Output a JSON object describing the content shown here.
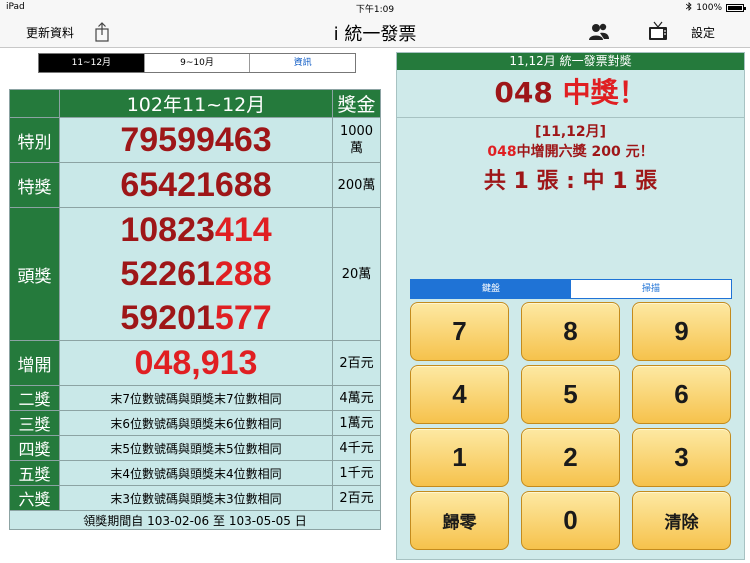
{
  "status": {
    "device": "iPad",
    "time": "下午1:09",
    "battery": "100%"
  },
  "nav": {
    "update_label": "更新資料",
    "title": "i 統一發票",
    "settings_label": "設定"
  },
  "left_tabs": [
    {
      "label": "11~12月",
      "active": true
    },
    {
      "label": "9~10月",
      "active": false
    },
    {
      "label": "資訊",
      "active": false
    }
  ],
  "table": {
    "header_title": "102年11~12月",
    "header_prize": "獎金",
    "special": {
      "label": "特別",
      "number": "79599463",
      "amount_line1": "1000",
      "amount_line2": "萬"
    },
    "grand": {
      "label": "特獎",
      "number": "65421688",
      "amount": "200萬"
    },
    "first": {
      "label": "頭獎",
      "amount": "20萬",
      "numbers": [
        {
          "head": "10823",
          "tail": "414"
        },
        {
          "head": "52261",
          "tail": "288"
        },
        {
          "head": "59201",
          "tail": "577"
        }
      ]
    },
    "extra": {
      "label": "增開",
      "number": "048,913",
      "amount": "2百元"
    },
    "rules": [
      {
        "label": "二獎",
        "desc": "末7位數號碼與頭獎末7位數相同",
        "amount": "4萬元"
      },
      {
        "label": "三獎",
        "desc": "末6位數號碼與頭獎末6位數相同",
        "amount": "1萬元"
      },
      {
        "label": "四獎",
        "desc": "末5位數號碼與頭獎末5位數相同",
        "amount": "4千元"
      },
      {
        "label": "五獎",
        "desc": "末4位數號碼與頭獎末4位數相同",
        "amount": "1千元"
      },
      {
        "label": "六獎",
        "desc": "末3位數號碼與頭獎末3位數相同",
        "amount": "2百元"
      }
    ],
    "period": "領獎期間自 103-02-06 至 103-05-05 日"
  },
  "checker": {
    "header": "11,12月 統一發票對獎",
    "input_number": "048",
    "result_text": "中獎！",
    "detail_line1": "[11,12月]",
    "detail_num": "048",
    "detail_line2": "中增開六獎",
    "detail_amount": "200",
    "detail_unit": "元！",
    "count_text": "共 1 張 : 中 1 張"
  },
  "right_tabs": [
    {
      "label": "鍵盤",
      "active": true
    },
    {
      "label": "掃描",
      "active": false
    }
  ],
  "keypad": {
    "k7": "7",
    "k8": "8",
    "k9": "9",
    "k4": "4",
    "k5": "5",
    "k6": "6",
    "k1": "1",
    "k2": "2",
    "k3": "3",
    "reset": "歸零",
    "k0": "0",
    "clear": "清除"
  },
  "colors": {
    "green": "#257a3c",
    "table_bg": "#c9e8e8",
    "dark_red": "#9e1618",
    "bright_red": "#e01f22",
    "key_gold": "#f6c24c",
    "accent_blue": "#1f73d6"
  }
}
